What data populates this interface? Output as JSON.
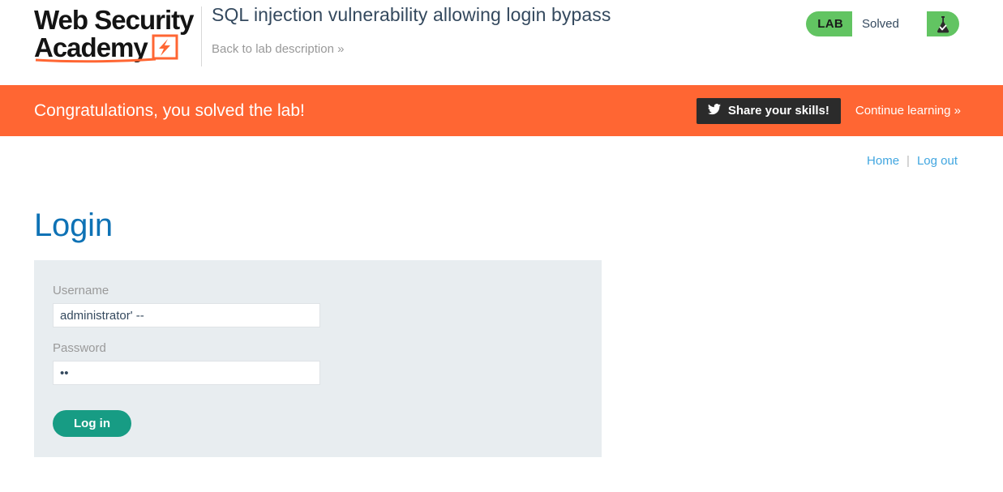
{
  "header": {
    "logo_line1": "Web Security",
    "logo_line2": "Academy",
    "logo_icon": "lightning-bolt-icon",
    "lab_title": "SQL injection vulnerability allowing login bypass",
    "back_link": "Back to lab description",
    "back_link_chevron": "»",
    "lab_status": {
      "tag": "LAB",
      "state": "Solved",
      "icon": "flask-check-icon",
      "accent_color": "#62c462"
    }
  },
  "banner": {
    "message": "Congratulations, you solved the lab!",
    "share_label": "Share your skills!",
    "share_icon": "twitter-bird-icon",
    "continue_label": "Continue learning",
    "continue_chevron": "»",
    "background_color": "#ff6633"
  },
  "nav": {
    "home": "Home",
    "separator": "|",
    "logout": "Log out",
    "link_color": "#41a6e0"
  },
  "main": {
    "page_title": "Login",
    "title_color": "#0e72b5",
    "form": {
      "username_label": "Username",
      "username_value": "administrator' --",
      "password_label": "Password",
      "password_value": "••",
      "password_masked_length": 2,
      "submit_label": "Log in",
      "submit_color": "#179c84",
      "panel_color": "#e8edf0"
    }
  }
}
